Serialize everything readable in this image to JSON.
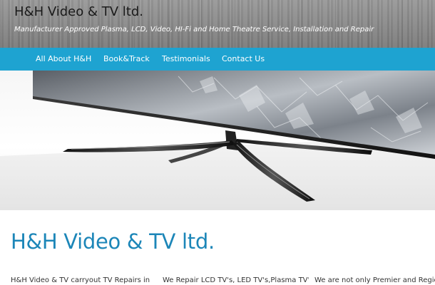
{
  "header": {
    "site_title": "H&H Video & TV ltd.",
    "tagline": "Manufacturer Approved Plasma, LCD, Video, HI-Fi and Home Theatre Service, Installation and Repair"
  },
  "nav": {
    "items": [
      {
        "label": "All About H&H"
      },
      {
        "label": "Book&Track"
      },
      {
        "label": "Testimonials"
      },
      {
        "label": "Contact Us"
      }
    ]
  },
  "hero": {
    "image": "tv-on-stand-image"
  },
  "main": {
    "heading": "H&H Video & TV ltd.",
    "columns": [
      {
        "text": "H&H Video & TV carryout TV Repairs in"
      },
      {
        "text": "We Repair LCD TV's, LED TV's,Plasma TV's, Blu-"
      },
      {
        "text": "We are not only Premier and Regional"
      }
    ]
  },
  "colors": {
    "nav_background": "#1ea3d1",
    "heading_blue": "#1c86b8",
    "header_wood": "#8c8c8c"
  }
}
